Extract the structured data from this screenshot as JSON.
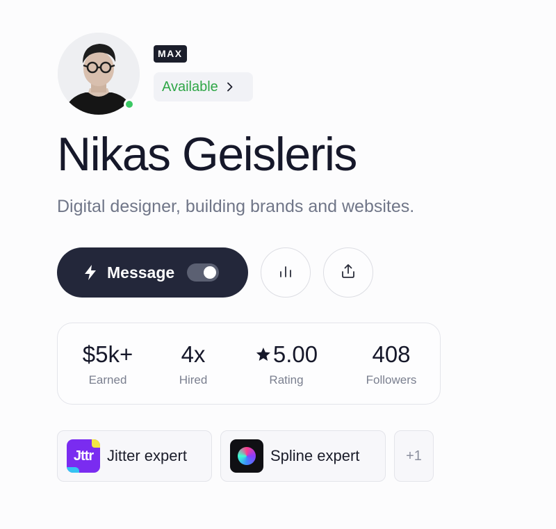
{
  "profile": {
    "plan_badge": "MAX",
    "availability": "Available",
    "name": "Nikas Geisleris",
    "bio": "Digital designer, building brands and websites."
  },
  "actions": {
    "message_label": "Message",
    "message_toggle_on": true
  },
  "stats": [
    {
      "value": "$5k+",
      "label": "Earned"
    },
    {
      "value": "4x",
      "label": "Hired"
    },
    {
      "value": "5.00",
      "label": "Rating",
      "icon": "star-icon"
    },
    {
      "value": "408",
      "label": "Followers"
    }
  ],
  "skills": [
    {
      "label": "Jitter expert",
      "logo_text": "Jttr"
    },
    {
      "label": "Spline expert"
    }
  ],
  "more_skills": "+1",
  "colors": {
    "primary_dark": "#23273a",
    "available_green": "#2ea646",
    "online_dot": "#3cc864",
    "jitter_purple": "#7a2cf0"
  }
}
